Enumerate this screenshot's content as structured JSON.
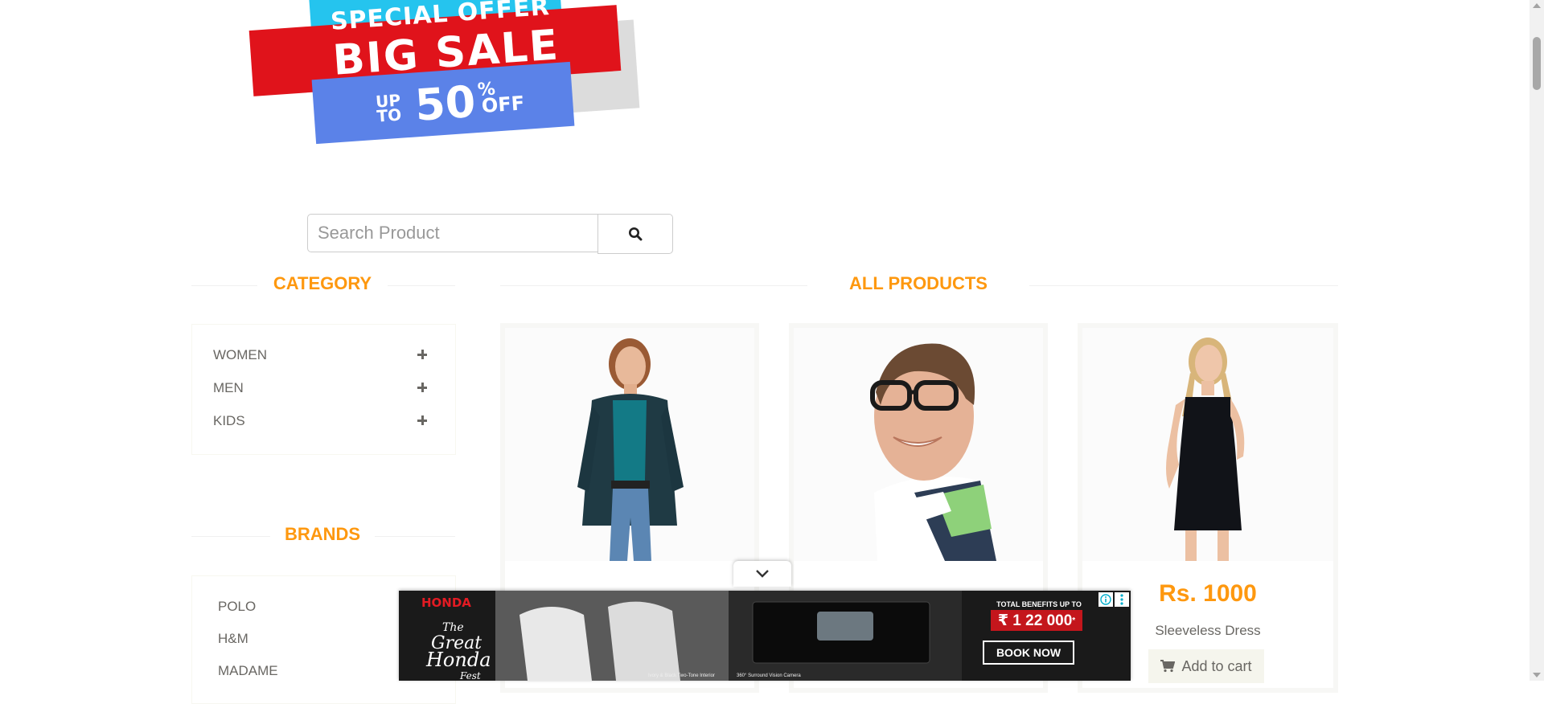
{
  "banner": {
    "line1": "SPECIAL OFFER",
    "line2": "BIG SALE",
    "up": "UP",
    "to": "TO",
    "amount": "50",
    "percent": "%",
    "off": "OFF"
  },
  "search": {
    "placeholder": "Search Product",
    "button_icon": "search-icon"
  },
  "category": {
    "title": "CATEGORY",
    "items": [
      {
        "label": "WOMEN",
        "icon": "plus-icon"
      },
      {
        "label": "MEN",
        "icon": "plus-icon"
      },
      {
        "label": "KIDS",
        "icon": "plus-icon"
      }
    ]
  },
  "brands": {
    "title": "BRANDS",
    "items": [
      "POLO",
      "H&M",
      "MADAME"
    ]
  },
  "products": {
    "title": "ALL PRODUCTS",
    "items": [
      {
        "price": "",
        "name": "",
        "button": ""
      },
      {
        "price": "",
        "name": "",
        "button": ""
      },
      {
        "price": "Rs. 1000",
        "name": "Sleeveless Dress",
        "button": "Add to cart"
      }
    ]
  },
  "ad": {
    "brand": "HONDA",
    "headline_1": "The",
    "headline_2": "Great",
    "headline_3": "Honda",
    "headline_4": "Fest",
    "benefits_label": "TOTAL BENEFITS UP TO",
    "benefits_value": "₹ 1 22 000",
    "benefits_sup": "*",
    "cta": "BOOK NOW",
    "caption_1": "Ivory & Black Two-Tone Interior",
    "caption_2": "360° Surround Vision Camera",
    "info_icon": "info-icon",
    "menu_icon": "more-vertical-icon",
    "toggle_icon": "chevron-down-icon"
  },
  "colors": {
    "accent": "#fe980f",
    "text": "#696763",
    "button_bg": "#f5f5ed"
  }
}
